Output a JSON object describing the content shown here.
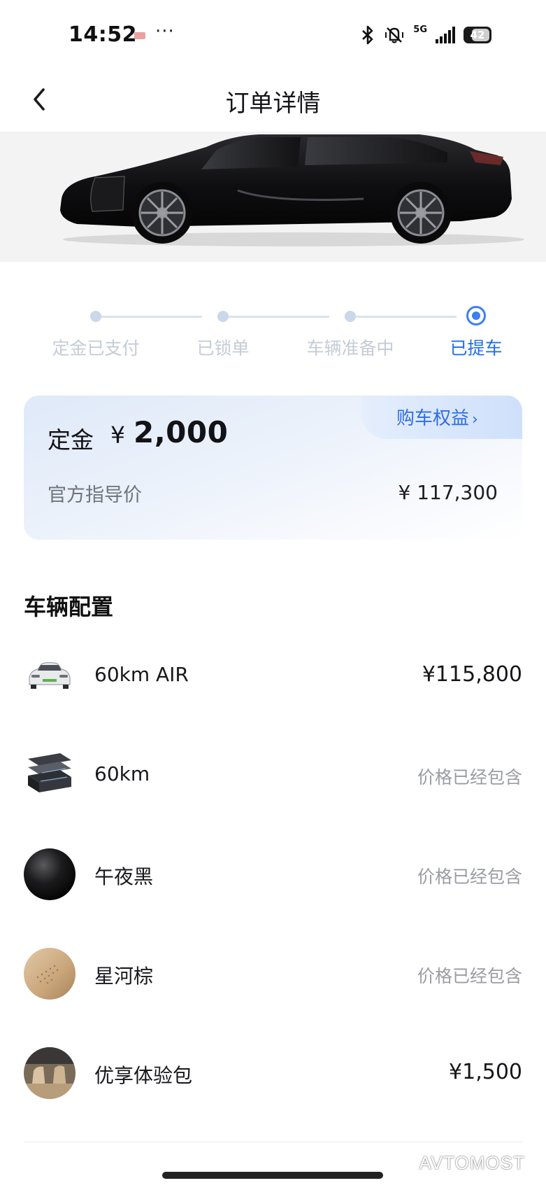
{
  "status_bar": {
    "time": "14:52",
    "dots": "···",
    "network": "5G",
    "battery": "42",
    "icons": [
      "notification-icon",
      "bluetooth-icon",
      "vibrate-off-icon",
      "signal-icon",
      "battery-icon"
    ]
  },
  "nav": {
    "back_icon": "chevron-left-icon",
    "title": "订单详情"
  },
  "progress": {
    "steps": [
      {
        "label": "定金已支付",
        "active": false
      },
      {
        "label": "已锁单",
        "active": false
      },
      {
        "label": "车辆准备中",
        "active": false
      },
      {
        "label": "已提车",
        "active": true
      }
    ],
    "active_color": "#1f6fe8",
    "inactive_color": "#c4ccd6"
  },
  "deposit_card": {
    "deposit_label": "定金",
    "currency_symbol": "¥",
    "deposit_amount": "2,000",
    "benefits_label": "购车权益",
    "benefits_chevron": "›",
    "msrp_label": "官方指导价",
    "msrp_value": "¥ 117,300"
  },
  "config": {
    "title": "车辆配置",
    "items": [
      {
        "icon": "car-thumbnail-icon",
        "name": "60km AIR",
        "price": "¥115,800"
      },
      {
        "icon": "battery-pack-icon",
        "name": "60km",
        "price": "价格已经包含"
      },
      {
        "icon": "black-paint-swatch-icon",
        "name": "午夜黑",
        "price": "价格已经包含"
      },
      {
        "icon": "brown-leather-swatch-icon",
        "name": "星河棕",
        "price": "价格已经包含"
      },
      {
        "icon": "interior-package-icon",
        "name": "优享体验包",
        "price": "¥1,500"
      }
    ]
  },
  "watermark": "AVTOMOST",
  "colors": {
    "accent": "#3c7ff0",
    "background": "#ffffff",
    "muted_text": "#9a9ca2"
  }
}
